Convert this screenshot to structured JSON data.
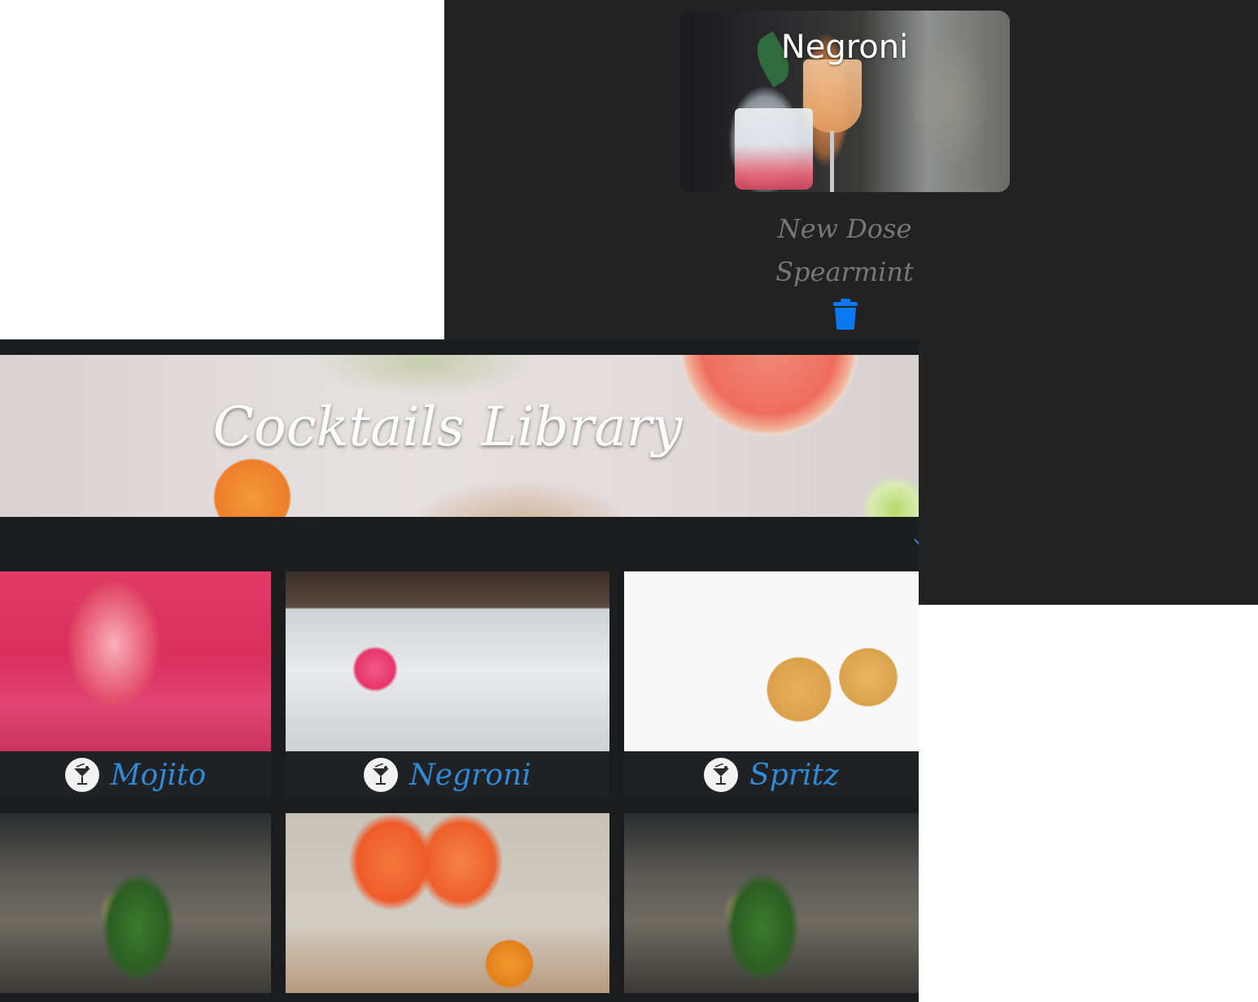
{
  "detail": {
    "title": "Negroni",
    "ingredients": [
      "New Dose",
      "Spearmint"
    ],
    "delete_icon": "trash-icon"
  },
  "library": {
    "title": "Cocktails Library",
    "cards": [
      {
        "name": "Mojito",
        "icon": "cocktail-glass-icon"
      },
      {
        "name": "Negroni",
        "icon": "cocktail-glass-icon"
      },
      {
        "name": "Spritz",
        "icon": "cocktail-glass-icon"
      }
    ]
  },
  "colors": {
    "detail_bg": "#222222",
    "library_bg": "#1b1c1e",
    "accent_blue": "#2f8ad8",
    "trash_blue": "#0a78f0"
  }
}
